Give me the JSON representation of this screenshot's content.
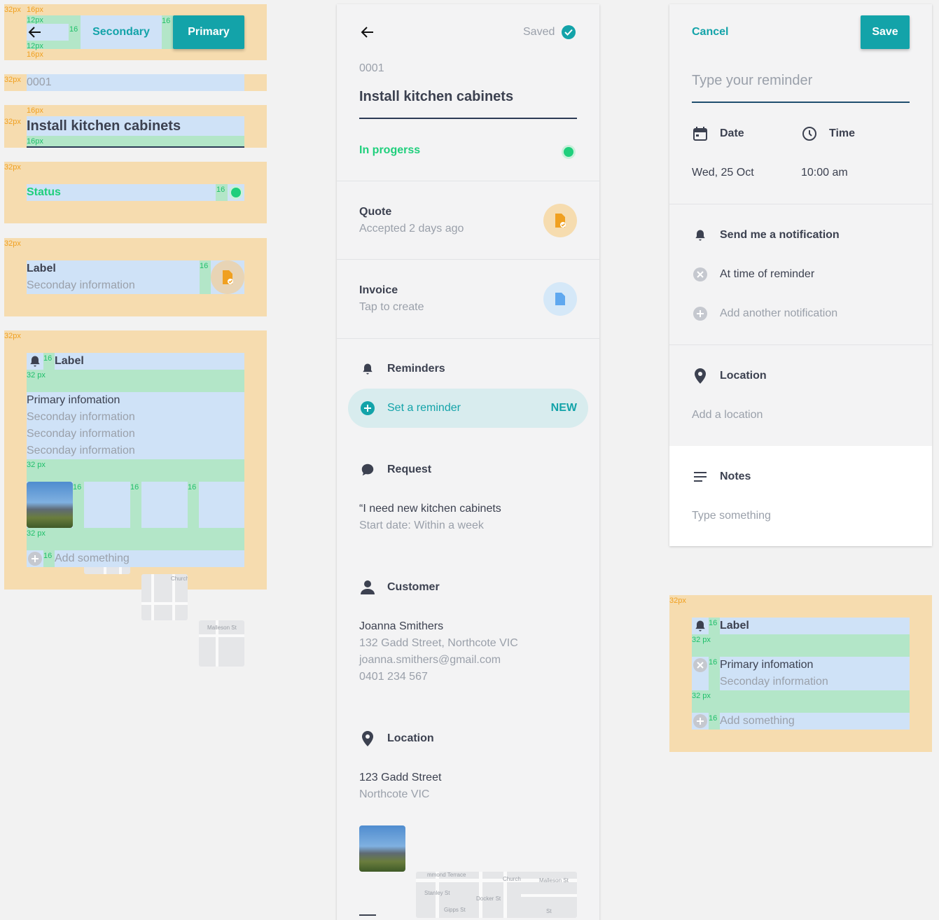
{
  "colors": {
    "teal": "#13a3a9",
    "green": "#1fcf7c",
    "grey": "#9aa0aa",
    "dark": "#3c4150",
    "spec_orange": "#f6dcaf",
    "spec_blue": "#cfe2f7",
    "spec_green": "#b3e6c8"
  },
  "spec": {
    "px32": "32px",
    "px16": "16px",
    "px12": "12px",
    "n16": "16",
    "px32s": "32 px",
    "secondary": "Secondary",
    "primary": "Primary",
    "number": "0001",
    "title": "Install kitchen cabinets",
    "status": "Status",
    "label": "Label",
    "secondary_info": "Seconday information",
    "primary_info": "Primary infomation",
    "add_something": "Add something",
    "primary_info_right": "Primary infomation",
    "icons": [
      "arrow-left-icon",
      "bell-icon",
      "document-icon",
      "plus-circle-icon",
      "close-circle-icon"
    ]
  },
  "job": {
    "saved": "Saved",
    "number": "0001",
    "title": "Install kitchen cabinets",
    "status": "In progerss",
    "quote": {
      "title": "Quote",
      "sub": "Accepted 2 days ago"
    },
    "invoice": {
      "title": "Invoice",
      "sub": "Tap to create"
    },
    "reminders": {
      "title": "Reminders",
      "set": "Set a reminder",
      "badge": "NEW"
    },
    "request": {
      "title": "Request",
      "line1": "“I need new kitchen cabinets",
      "line2": "Start date: Within a week"
    },
    "customer": {
      "title": "Customer",
      "name": "Joanna Smithers",
      "address": "132 Gadd Street, Northcote VIC",
      "email": "joanna.smithers@gmail.com",
      "phone": "0401 234 567"
    },
    "location": {
      "title": "Location",
      "line1": "123 Gadd Street",
      "line2": "Northcote VIC"
    }
  },
  "reminder": {
    "cancel": "Cancel",
    "save": "Save",
    "placeholder": "Type your reminder",
    "date_label": "Date",
    "time_label": "Time",
    "date_value": "Wed, 25 Oct",
    "time_value": "10:00 am",
    "notification_title": "Send me a notification",
    "at_time": "At time of reminder",
    "add_notification": "Add another notification",
    "location_title": "Location",
    "location_add": "Add a location",
    "notes_title": "Notes",
    "notes_placeholder": "Type something"
  },
  "map_labels": [
    "mmond Terrace",
    "Stanley St",
    "Gipps St",
    "Docker St",
    "Church",
    "Malleson St",
    "St"
  ]
}
